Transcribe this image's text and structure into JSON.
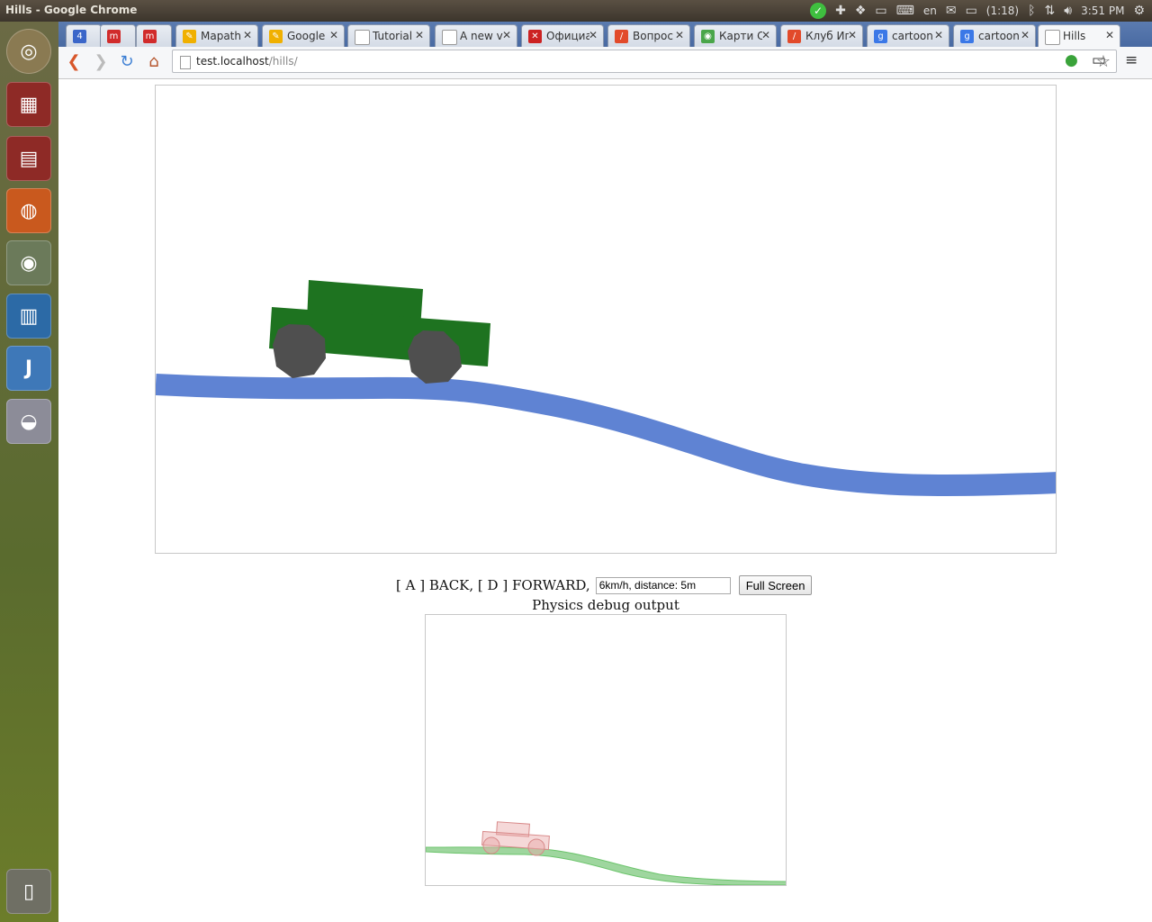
{
  "window": {
    "title": "Hills - Google Chrome"
  },
  "tray": {
    "keyboard_layout": "en",
    "battery": "(1:18)",
    "clock": "3:51 PM"
  },
  "tabs": [
    {
      "label": "",
      "icon": "4",
      "color": "#3b66c9"
    },
    {
      "label": "",
      "icon": "m",
      "color": "#d12b2b"
    },
    {
      "label": "",
      "icon": "m",
      "color": "#d12b2b"
    },
    {
      "label": "Mapath",
      "icon": "✎",
      "color": "#f0b000"
    },
    {
      "label": "Google",
      "icon": "✎",
      "color": "#f0b000"
    },
    {
      "label": "Tutorial",
      "icon": "",
      "color": "#ffffff"
    },
    {
      "label": "A new v",
      "icon": "",
      "color": "#ffffff"
    },
    {
      "label": "Официа",
      "icon": "✕",
      "color": "#cc2222"
    },
    {
      "label": "Вопрос",
      "icon": "/",
      "color": "#e24a2a"
    },
    {
      "label": "Карти С",
      "icon": "◉",
      "color": "#4aa64a"
    },
    {
      "label": "Клуб Иг",
      "icon": "/",
      "color": "#e24a2a"
    },
    {
      "label": "cartoon",
      "icon": "g",
      "color": "#3b78e7"
    },
    {
      "label": "cartoon",
      "icon": "g",
      "color": "#3b78e7"
    },
    {
      "label": "Hills",
      "icon": "",
      "color": "#ffffff"
    }
  ],
  "address": {
    "host": "test.localhost",
    "path": "/hills/"
  },
  "controls": {
    "instructions": "[ A ] BACK, [ D ] FORWARD,",
    "status_value": "6km/h, distance: 5m",
    "fullscreen_label": "Full Screen"
  },
  "debug": {
    "title": "Physics debug output"
  },
  "colors": {
    "car_body": "#1e7320",
    "wheel": "#4f4f4f",
    "ground": "#5f83d3",
    "debug_ground": "#9ed69e",
    "debug_car": "#e8a8a8"
  }
}
